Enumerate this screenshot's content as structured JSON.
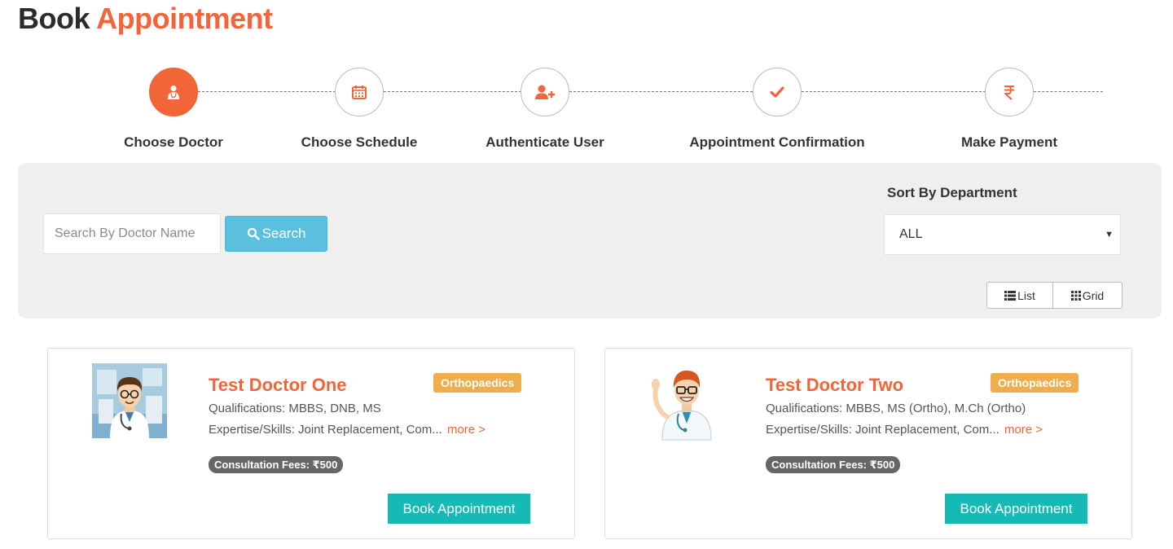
{
  "page": {
    "title_part1": "Book",
    "title_part2": "Appointment",
    "accent_color": "#f26538",
    "teal_color": "#17b9b6"
  },
  "steps": [
    {
      "label": "Choose Doctor",
      "icon": "doctor-icon",
      "active": true
    },
    {
      "label": "Choose Schedule",
      "icon": "calendar-icon",
      "active": false
    },
    {
      "label": "Authenticate User",
      "icon": "add-user-icon",
      "active": false
    },
    {
      "label": "Appointment Confirmation",
      "icon": "check-icon",
      "active": false
    },
    {
      "label": "Make Payment",
      "icon": "rupee-icon",
      "active": false
    }
  ],
  "filters": {
    "search_placeholder": "Search By Doctor Name",
    "search_label": "Search",
    "sort_label": "Sort By Department",
    "department_selected": "ALL",
    "view_list_label": "List",
    "view_grid_label": "Grid"
  },
  "doctors": [
    {
      "name": "Test Doctor One",
      "department": "Orthopaedics",
      "qualifications": "Qualifications: MBBS, DNB, MS",
      "skills": "Expertise/Skills: Joint Replacement, Com...",
      "more_label": "more >",
      "fees": "Consultation Fees: ₹500",
      "book_label": "Book Appointment"
    },
    {
      "name": "Test Doctor Two",
      "department": "Orthopaedics",
      "qualifications": "Qualifications: MBBS, MS (Ortho), M.Ch (Ortho)",
      "skills": "Expertise/Skills: Joint Replacement, Com...",
      "more_label": "more >",
      "fees": "Consultation Fees: ₹500",
      "book_label": "Book Appointment"
    }
  ]
}
